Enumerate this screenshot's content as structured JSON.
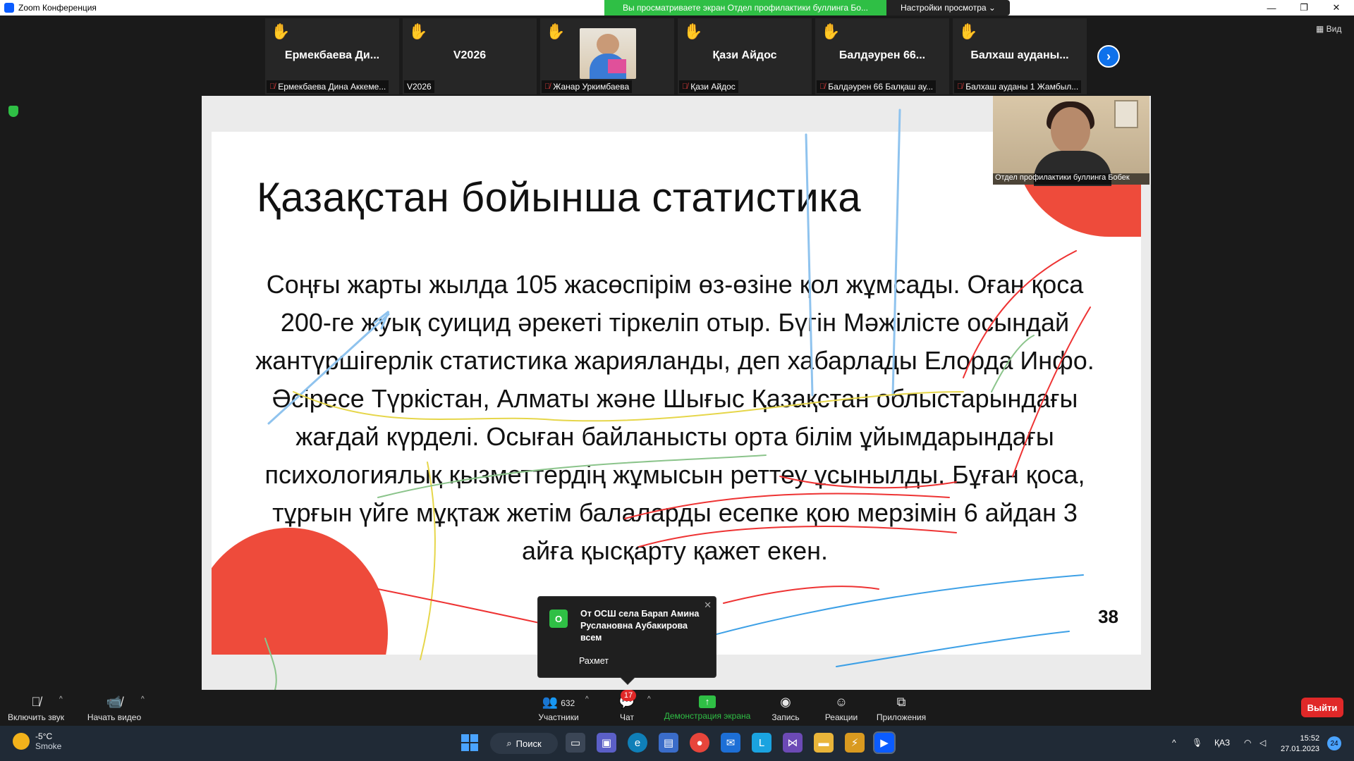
{
  "titlebar": {
    "app_title": "Zoom Конференция",
    "share_banner": "Вы просматриваете экран Отдел профилактики буллинга Бо...",
    "view_options": "Настройки просмотра ⌄"
  },
  "participants": [
    {
      "display": "Ермекбаева  Ди...",
      "name": "Ермекбаева Дина Аккеме...",
      "muted": true,
      "hand_raised": true
    },
    {
      "display": "V2026",
      "name": "V2026",
      "muted": false,
      "hand_raised": true
    },
    {
      "display": "",
      "name": "Жанар Уркимбаева",
      "muted": true,
      "hand_raised": true,
      "has_video": true
    },
    {
      "display": "Қази Айдос",
      "name": "Қази Айдос",
      "muted": true,
      "hand_raised": true
    },
    {
      "display": "Балдәурен  66...",
      "name": "Балдәурен 66  Балқаш ау...",
      "muted": true,
      "hand_raised": true
    },
    {
      "display": "Балхаш  ауданы...",
      "name": "Балхаш ауданы 1 Жамбыл...",
      "muted": true,
      "hand_raised": true
    }
  ],
  "view_button": "Вид",
  "slide": {
    "title": "Қазақстан бойынша статистика",
    "body": "Соңғы жарты жылда 105 жасөспірім өз-өзіне қол жұмсады. Оған қоса 200-ге жуық суицид әрекеті тіркеліп отыр. Бүгін Мәжілісте осындай жантүршігерлік статистика жарияланды, деп хабарлады Елорда Инфо. Әсіресе Түркістан, Алматы және Шығыс Қазақстан облыстарындағы жағдай күрделі. Осыған байланысты орта білім ұйымдарындағы психологиялық қызметтердің жұмысын реттеу ұсынылды. Бұған қоса, тұрғын үйге мұқтаж жетім балаларды есепке қою мерзімін 6 айдан 3 айға қысқарту қажет екен.",
    "page_number": "38"
  },
  "presenter": {
    "name": "Отдел профилактики буллинга Бобек"
  },
  "chat_toast": {
    "avatar_letter": "О",
    "from": "От ОСШ села Барап Амина Руслановна Аубакирова всем",
    "message": "Рахмет"
  },
  "toolbar": {
    "audio_label": "Включить звук",
    "video_label": "Начать видео",
    "participants_label": "Участники",
    "participants_count": "632",
    "chat_label": "Чат",
    "chat_badge": "17",
    "share_label": "Демонстрация экрана",
    "record_label": "Запись",
    "reactions_label": "Реакции",
    "apps_label": "Приложения",
    "leave_label": "Выйти"
  },
  "taskbar": {
    "weather_temp": "-5°C",
    "weather_desc": "Smoke",
    "search_label": "Поиск",
    "language": "ҚАЗ",
    "time": "15:52",
    "date": "27.01.2023",
    "notification_count": "24"
  },
  "colors": {
    "accent_blue": "#0e71eb",
    "share_green": "#2fbf45",
    "leave_red": "#e02828",
    "slide_deco": "#ee4b3b"
  }
}
